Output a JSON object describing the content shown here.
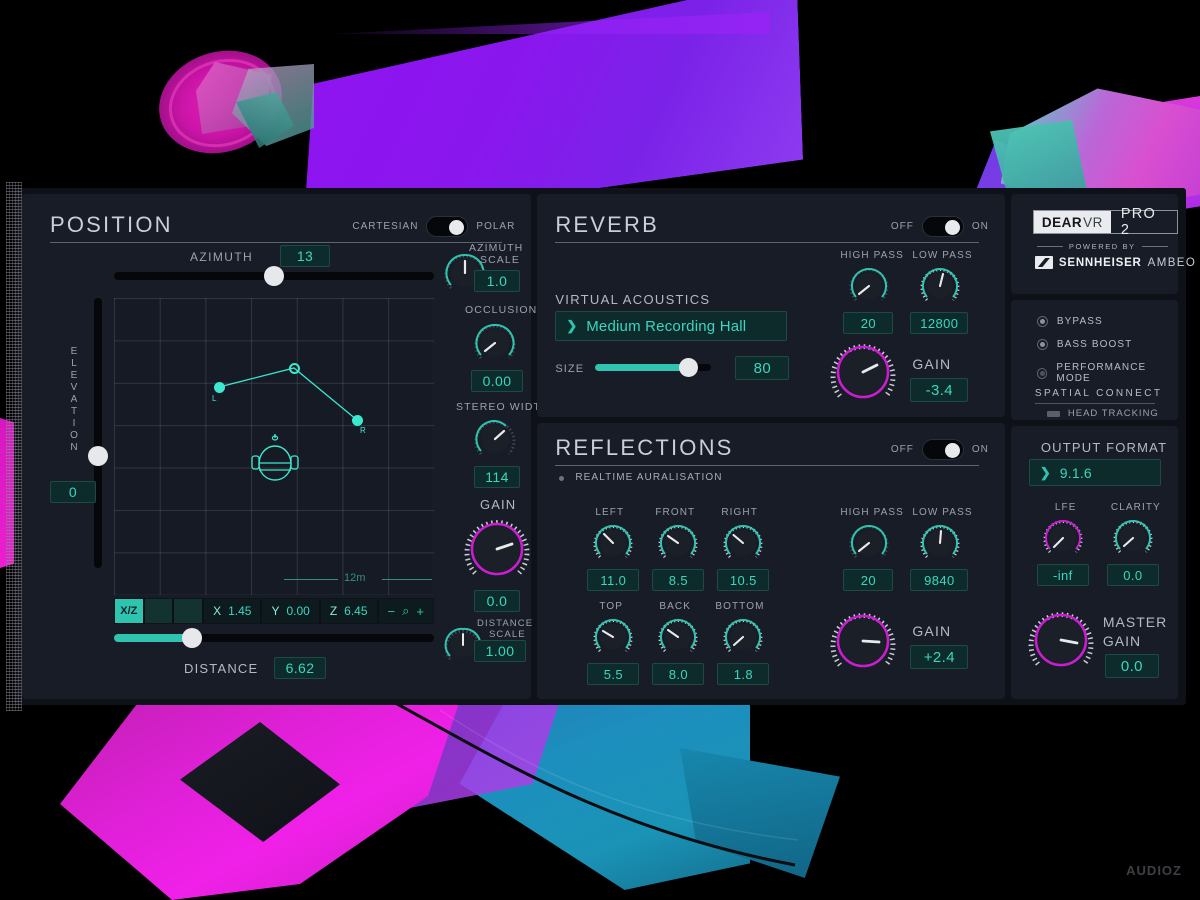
{
  "brand": {
    "name_bold": "DEAR",
    "name_light": "VR",
    "edition": "PRO 2",
    "powered_by": "POWERED BY",
    "maker": "SENNHEISER",
    "tech": "AMBEO"
  },
  "watermark": "AUDIOZ",
  "position": {
    "title": "POSITION",
    "mode_left": "CARTESIAN",
    "mode_right": "POLAR",
    "mode_state": "on",
    "azimuth_label": "AZIMUTH",
    "azimuth_value": "13",
    "elevation_label": "ELEVATION",
    "elevation_value": "0",
    "distance_label": "DISTANCE",
    "distance_value": "6.62",
    "grid_scale": "12m",
    "point_l": "L",
    "point_r": "R",
    "coords": {
      "tab_active": "X/Z",
      "x_key": "X",
      "x_val": "1.45",
      "y_key": "Y",
      "y_val": "0.00",
      "z_key": "Z",
      "z_val": "6.45",
      "zoom_out": "−",
      "zoom_icon": "⌕",
      "zoom_in": "+"
    },
    "knobs": [
      {
        "label": "AZIMUTH\nSCALE",
        "label1": "AZIMUTH",
        "label2": "SCALE",
        "value": "1.0"
      },
      {
        "label": "OCCLUSION",
        "value": "0.00"
      },
      {
        "label": "STEREO WIDTH",
        "value": "114"
      },
      {
        "label": "GAIN",
        "value": "0.0"
      },
      {
        "label1": "DISTANCE",
        "label2": "SCALE",
        "value": "1.00"
      }
    ]
  },
  "reverb": {
    "title": "REVERB",
    "toggle_off": "OFF",
    "toggle_on": "ON",
    "toggle_state": "on",
    "virtual_acoustics_label": "VIRTUAL ACOUSTICS",
    "preset": "Medium Recording Hall",
    "size_label": "SIZE",
    "size_value": "80",
    "high_pass_label": "HIGH PASS",
    "high_pass_value": "20",
    "low_pass_label": "LOW PASS",
    "low_pass_value": "12800",
    "gain_label": "GAIN",
    "gain_value": "-3.4"
  },
  "reflections": {
    "title": "REFLECTIONS",
    "toggle_off": "OFF",
    "toggle_on": "ON",
    "toggle_state": "on",
    "realtime_label": "REALTIME AURALISATION",
    "walls": [
      {
        "label": "LEFT",
        "value": "11.0"
      },
      {
        "label": "FRONT",
        "value": "8.5"
      },
      {
        "label": "RIGHT",
        "value": "10.5"
      },
      {
        "label": "TOP",
        "value": "5.5"
      },
      {
        "label": "BACK",
        "value": "8.0"
      },
      {
        "label": "BOTTOM",
        "value": "1.8"
      }
    ],
    "high_pass_label": "HIGH PASS",
    "high_pass_value": "20",
    "low_pass_label": "LOW PASS",
    "low_pass_value": "9840",
    "gain_label": "GAIN",
    "gain_value": "+2.4"
  },
  "options": {
    "items": [
      {
        "label": "BYPASS"
      },
      {
        "label": "BASS BOOST"
      },
      {
        "label": "PERFORMANCE MODE"
      }
    ],
    "spatial_connect": "SPATIAL CONNECT",
    "head_tracking": "HEAD TRACKING"
  },
  "output": {
    "title": "OUTPUT FORMAT",
    "format": "9.1.6",
    "lfe_label": "LFE",
    "lfe_value": "-inf",
    "clarity_label": "CLARITY",
    "clarity_value": "0.0",
    "master_gain_label1": "MASTER",
    "master_gain_label2": "GAIN",
    "master_gain_value": "0.0"
  },
  "colors": {
    "teal": "#2ec4b0",
    "teal_text": "#3ad6c0",
    "magenta": "#c81ed0",
    "panel": "#181c26",
    "window": "#0e1118"
  }
}
